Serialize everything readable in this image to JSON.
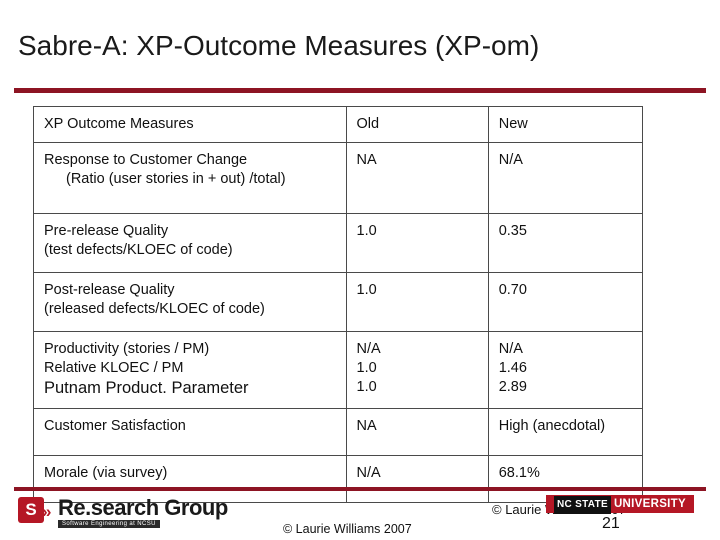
{
  "slide": {
    "title": "Sabre-A:  XP-Outcome Measures (XP-om)",
    "page_number": "21"
  },
  "table": {
    "headers": [
      "XP Outcome Measures",
      "Old",
      "New"
    ],
    "rows": [
      {
        "measure_line1": "Response to Customer Change",
        "measure_line2": "(Ratio (user stories in + out) /total)",
        "old": "NA",
        "new": "N/A"
      },
      {
        "measure_line1": "Pre-release Quality",
        "measure_line2": "(test defects/KLOEC of code)",
        "old": "1.0",
        "new": "0.35"
      },
      {
        "measure_line1": "Post-release Quality",
        "measure_line2": "(released defects/KLOEC of code)",
        "old": "1.0",
        "new": "0.70"
      },
      {
        "measure_line1": "Productivity (stories / PM)",
        "measure_line2": "Relative KLOEC / PM",
        "measure_line3": "Putnam Product. Parameter",
        "old_line1": "N/A",
        "old_line2": "1.0",
        "old_line3": "1.0",
        "new_line1": "N/A",
        "new_line2": "1.46",
        "new_line3": "2.89"
      },
      {
        "measure_line1": "Customer Satisfaction",
        "old": "NA",
        "new": "High (anecdotal)"
      },
      {
        "measure_line1": "Morale (via survey)",
        "old": "N/A",
        "new": "68.1%"
      }
    ]
  },
  "footer": {
    "logo_mark": "S",
    "logo_chevron": "»",
    "logo_name": "Re.search Group",
    "logo_subtitle": "Software Engineering at NCSU",
    "copyright_center": "© Laurie Williams 2007",
    "copyright_right": "© Laurie Williams 2007",
    "university_prefix": "NC STATE",
    "university_name": "UNIVERSITY"
  }
}
